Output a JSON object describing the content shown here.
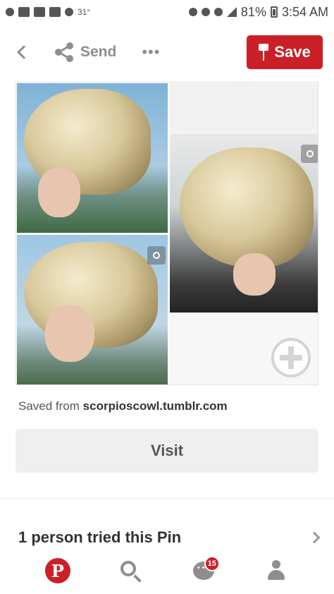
{
  "status_bar": {
    "temperature": "31°",
    "battery_percent": "81%",
    "time": "3:54 AM"
  },
  "toolbar": {
    "send_label": "Send",
    "more_label": "•••",
    "save_label": "Save"
  },
  "source": {
    "prefix": "Saved from ",
    "domain": "scorpioscowl.tumblr.com"
  },
  "visit_label": "Visit",
  "tried": {
    "label": "1 person tried this Pin"
  },
  "bottom_nav": {
    "logo_glyph": "P",
    "notification_count": "15"
  },
  "colors": {
    "accent": "#cb1f27",
    "icon_gray": "#8e8e8e"
  }
}
